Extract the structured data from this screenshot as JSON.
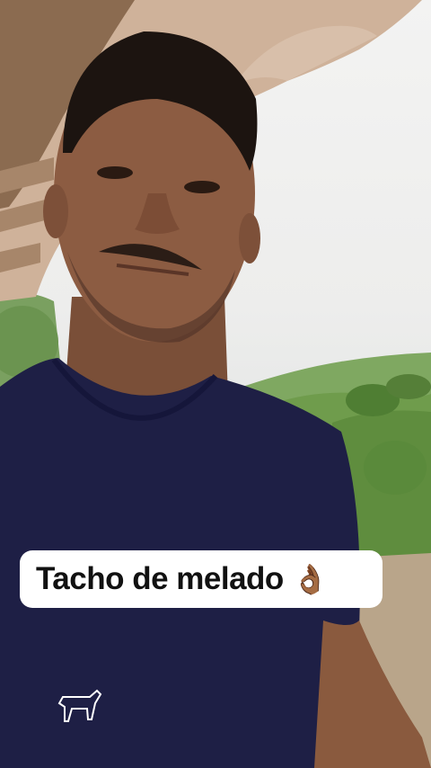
{
  "caption": {
    "text": "Tacho de melado",
    "emoji": "👌🏾",
    "emoji_name": "ok-hand-emoji",
    "background": "#ffffff",
    "color": "#111111"
  },
  "scene": {
    "subject": "man-selfie",
    "shirt_color": "#1e1f45",
    "hill_color": "#6f9c4c",
    "roof_color": "#c9a98e"
  }
}
